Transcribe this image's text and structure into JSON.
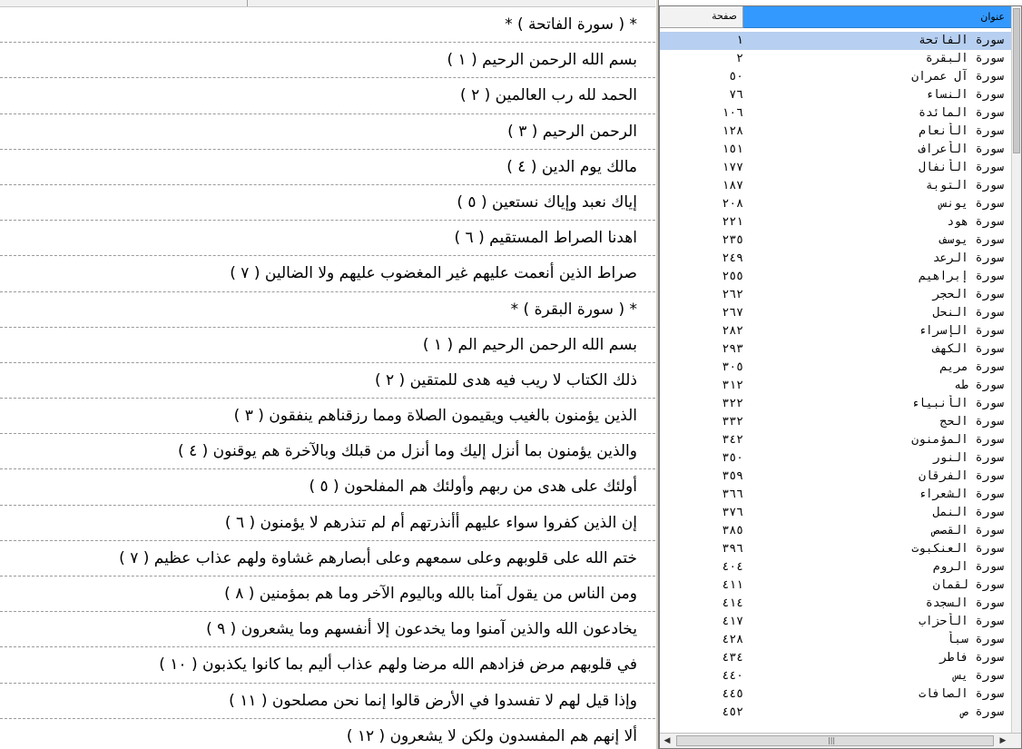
{
  "text_pane": {
    "lines": [
      "* ( سورة الفاتحة ) *",
      "بسم الله الرحمن الرحيم ( ١ )",
      "الحمد لله رب العالمين ( ٢ )",
      "الرحمن الرحيم ( ٣ )",
      "مالك يوم الدين ( ٤ )",
      "إياك نعبد وإياك نستعين ( ٥ )",
      "اهدنا الصراط المستقيم ( ٦ )",
      "صراط الذين أنعمت عليهم غير المغضوب عليهم ولا الضالين ( ٧ )",
      "* ( سورة البقرة ) *",
      "بسم الله الرحمن الرحيم الم ( ١ )",
      "ذلك الكتاب لا ريب فيه هدى للمتقين ( ٢ )",
      "الذين يؤمنون بالغيب ويقيمون الصلاة ومما رزقناهم ينفقون ( ٣ )",
      "والذين يؤمنون بما أنزل إليك وما أنزل من قبلك وبالآخرة هم يوقنون ( ٤ )",
      "أولئك على هدى من ربهم وأولئك هم المفلحون ( ٥ )",
      "إن الذين كفروا سواء عليهم أأنذرتهم أم لم تنذرهم لا يؤمنون ( ٦ )",
      "ختم الله على قلوبهم وعلى سمعهم وعلى أبصارهم غشاوة ولهم عذاب عظيم ( ٧ )",
      "ومن الناس من يقول آمنا بالله وباليوم الآخر وما هم بمؤمنين ( ٨ )",
      "يخادعون الله والذين آمنوا وما يخدعون إلا أنفسهم وما يشعرون ( ٩ )",
      "في قلوبهم مرض فزادهم الله مرضا ولهم عذاب أليم بما كانوا يكذبون ( ١٠ )",
      "وإذا قيل لهم لا تفسدوا في الأرض قالوا إنما نحن مصلحون ( ١١ )",
      "ألا إنهم هم المفسدون ولكن لا يشعرون ( ١٢ )"
    ]
  },
  "index_pane": {
    "header": {
      "title": "عنوان",
      "page": "صفحة"
    },
    "selected_row": 0,
    "rows": [
      {
        "title": "سورة الفاتحة",
        "page": "١"
      },
      {
        "title": "سورة البقرة",
        "page": "٢"
      },
      {
        "title": "سورة آل عمران",
        "page": "٥٠"
      },
      {
        "title": "سورة النساء",
        "page": "٧٦"
      },
      {
        "title": "سورة المائدة",
        "page": "١٠٦"
      },
      {
        "title": "سورة الأنعام",
        "page": "١٢٨"
      },
      {
        "title": "سورة الأعراف",
        "page": "١٥١"
      },
      {
        "title": "سورة الأنفال",
        "page": "١٧٧"
      },
      {
        "title": "سورة التوبة",
        "page": "١٨٧"
      },
      {
        "title": "سورة يونس",
        "page": "٢٠٨"
      },
      {
        "title": "سورة هود",
        "page": "٢٢١"
      },
      {
        "title": "سورة يوسف",
        "page": "٢٣٥"
      },
      {
        "title": "سورة الرعد",
        "page": "٢٤٩"
      },
      {
        "title": "سورة إبراهيم",
        "page": "٢٥٥"
      },
      {
        "title": "سورة الحجر",
        "page": "٢٦٢"
      },
      {
        "title": "سورة النحل",
        "page": "٢٦٧"
      },
      {
        "title": "سورة الإسراء",
        "page": "٢٨٢"
      },
      {
        "title": "سورة الكهف",
        "page": "٢٩٣"
      },
      {
        "title": "سورة مريم",
        "page": "٣٠٥"
      },
      {
        "title": "سورة طه",
        "page": "٣١٢"
      },
      {
        "title": "سورة الأنبياء",
        "page": "٣٢٢"
      },
      {
        "title": "سورة الحج",
        "page": "٣٣٢"
      },
      {
        "title": "سورة المؤمنون",
        "page": "٣٤٢"
      },
      {
        "title": "سورة النور",
        "page": "٣٥٠"
      },
      {
        "title": "سورة الفرقان",
        "page": "٣٥٩"
      },
      {
        "title": "سورة الشعراء",
        "page": "٣٦٦"
      },
      {
        "title": "سورة النمل",
        "page": "٣٧٦"
      },
      {
        "title": "سورة القصص",
        "page": "٣٨٥"
      },
      {
        "title": "سورة العنكبوت",
        "page": "٣٩٦"
      },
      {
        "title": "سورة الروم",
        "page": "٤٠٤"
      },
      {
        "title": "سورة لقمان",
        "page": "٤١١"
      },
      {
        "title": "سورة السجدة",
        "page": "٤١٤"
      },
      {
        "title": "سورة الأحزاب",
        "page": "٤١٧"
      },
      {
        "title": "سورة سبأ",
        "page": "٤٢٨"
      },
      {
        "title": "سورة فاطر",
        "page": "٤٣٤"
      },
      {
        "title": "سورة يس",
        "page": "٤٤٠"
      },
      {
        "title": "سورة الصافات",
        "page": "٤٤٥"
      },
      {
        "title": "سورة ص",
        "page": "٤٥٢"
      }
    ]
  }
}
